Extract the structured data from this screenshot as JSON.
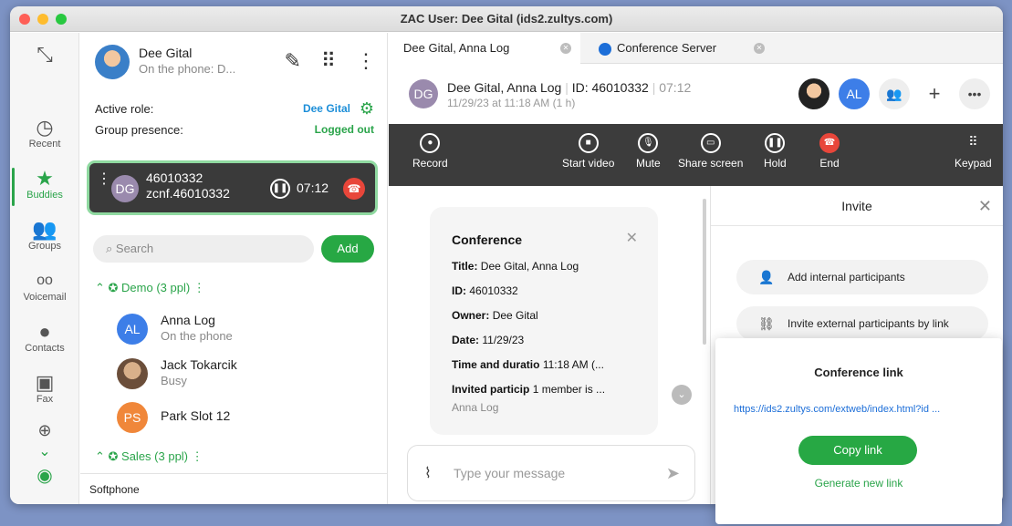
{
  "window": {
    "title": "ZAC User: Dee Gital (ids2.zultys.com)"
  },
  "rail": {
    "items": [
      {
        "label": "Recent",
        "icon": "clock-icon"
      },
      {
        "label": "Buddies",
        "icon": "star-icon"
      },
      {
        "label": "Groups",
        "icon": "group-icon"
      },
      {
        "label": "Voicemail",
        "icon": "voicemail-icon"
      },
      {
        "label": "Contacts",
        "icon": "person-icon"
      },
      {
        "label": "Fax",
        "icon": "fax-icon"
      }
    ]
  },
  "profile": {
    "name": "Dee Gital",
    "status": "On the phone: D...",
    "active_role_label": "Active role:",
    "active_role_value": "Dee Gital",
    "group_presence_label": "Group presence:",
    "group_presence_value": "Logged out"
  },
  "active_call": {
    "initials": "DG",
    "number": "46010332",
    "sub": "zcnf.46010332",
    "time": "07:12"
  },
  "search": {
    "placeholder": "Search",
    "add_label": "Add"
  },
  "groups": [
    {
      "label": "Demo (3 ppl)",
      "buddies": [
        {
          "initials": "AL",
          "name": "Anna Log",
          "status": "On the phone",
          "color": "#3d7ee8"
        },
        {
          "initials": "",
          "name": "Jack Tokarcik",
          "status": "Busy",
          "color": "#8a6a50"
        },
        {
          "initials": "PS",
          "name": "Park Slot 12",
          "status": "",
          "color": "#f0873a"
        }
      ]
    },
    {
      "label": "Sales (3 ppl)",
      "buddies": []
    }
  ],
  "softphone_label": "Softphone",
  "tabs": [
    {
      "label": "Dee Gital, Anna Log"
    },
    {
      "label": "Conference Server"
    }
  ],
  "call_header": {
    "initials": "DG",
    "title": "Dee Gital, Anna Log",
    "id_text": "ID: 46010332",
    "duration": "07:12",
    "date_line": "11/29/23 at 11:18 AM (1 h)",
    "avatar_al": "AL"
  },
  "toolbar": {
    "record": "Record",
    "start_video": "Start video",
    "mute": "Mute",
    "share_screen": "Share screen",
    "hold": "Hold",
    "end": "End",
    "keypad": "Keypad"
  },
  "conference": {
    "heading": "Conference",
    "title_label": "Title:",
    "title_value": "Dee Gital, Anna Log",
    "id_label": "ID:",
    "id_value": "46010332",
    "owner_label": "Owner:",
    "owner_value": "Dee Gital",
    "date_label": "Date:",
    "date_value": "11/29/23",
    "time_label": "Time and duratio",
    "time_value": "11:18 AM (...",
    "invited_label": "Invited particip",
    "invited_value": "1 member is ...",
    "participant": "Anna Log"
  },
  "message": {
    "placeholder": "Type your message"
  },
  "invite": {
    "title": "Invite",
    "internal": "Add internal participants",
    "external": "Invite external participants by link"
  },
  "link_popup": {
    "title": "Conference link",
    "url": "https://ids2.zultys.com/extweb/index.html?id ...",
    "copy": "Copy link",
    "generate": "Generate new link"
  }
}
